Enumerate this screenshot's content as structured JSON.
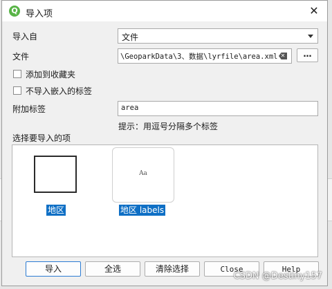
{
  "window": {
    "title": "导入项",
    "close_glyph": "✕"
  },
  "form": {
    "import_from_label": "导入自",
    "import_from_value": "文件",
    "file_label": "文件",
    "file_path": "\\GeoparkData\\3、数据\\lyrfile\\area.xml",
    "browse_label": "…",
    "add_to_favorites_label": "添加到收藏夹",
    "no_embedded_tags_label": "不导入嵌入的标签",
    "extra_tags_label": "附加标签",
    "extra_tags_value": "area",
    "tags_hint": "提示：用逗号分隔多个标签",
    "select_items_label": "选择要导入的项"
  },
  "items": [
    {
      "label": "地区",
      "preview_text": ""
    },
    {
      "label": "地区 labels",
      "preview_text": "Aa"
    }
  ],
  "buttons": {
    "import": "导入",
    "select_all": "全选",
    "clear_selection": "清除选择",
    "close": "Close",
    "help": "Help"
  },
  "watermark": "CSDN @Destiny157",
  "colors": {
    "selection": "#0e6fc5",
    "app_icon": "#58b447"
  },
  "icons": {
    "app": "qgis-logo-icon",
    "clear": "backspace-clear-icon"
  }
}
